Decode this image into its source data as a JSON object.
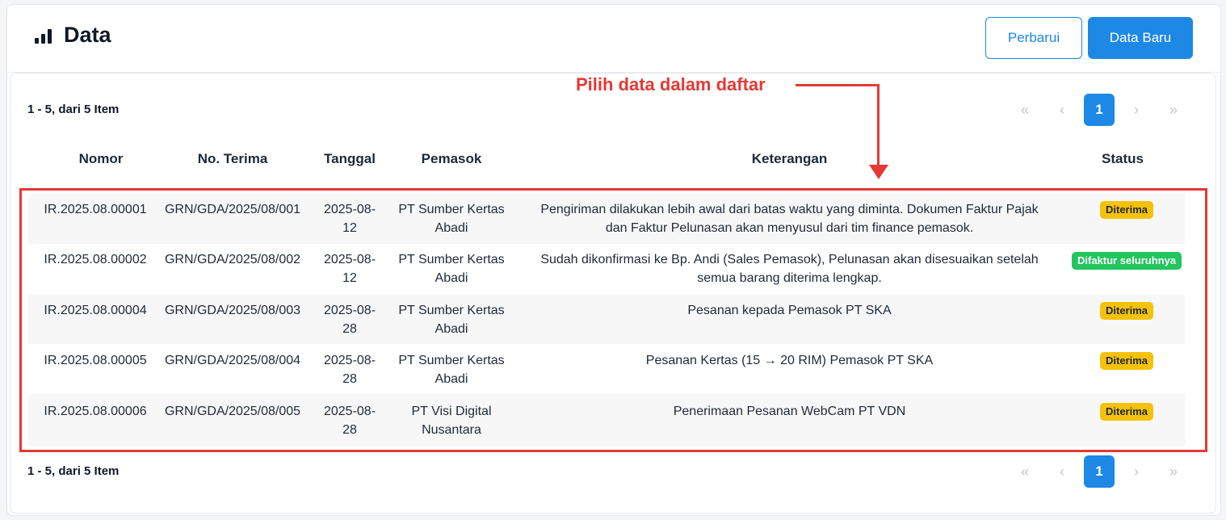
{
  "header": {
    "title": "Data",
    "icon": "bar-chart-icon",
    "refresh_label": "Perbarui",
    "new_label": "Data Baru"
  },
  "annotation": {
    "text": "Pilih data dalam daftar",
    "color": "#e53935"
  },
  "summary": {
    "count_text": "1 - 5, dari 5 Item"
  },
  "pagination": {
    "first": "«",
    "prev": "‹",
    "current": "1",
    "next": "›",
    "last": "»"
  },
  "table": {
    "columns": [
      "Nomor",
      "No. Terima",
      "Tanggal",
      "Pemasok",
      "Keterangan",
      "Status"
    ],
    "rows": [
      {
        "nomor": "IR.2025.08.00001",
        "no_terima": "GRN/GDA/2025/08/001",
        "tanggal_1": "2025-08-",
        "tanggal_2": "12",
        "pemasok_1": "PT Sumber Kertas",
        "pemasok_2": "Abadi",
        "keterangan_1": "Pengiriman dilakukan lebih awal dari batas waktu yang diminta. Dokumen Faktur Pajak",
        "keterangan_2": "dan Faktur Pelunasan akan menyusul dari tim finance pemasok.",
        "status": "Diterima"
      },
      {
        "nomor": "IR.2025.08.00002",
        "no_terima": "GRN/GDA/2025/08/002",
        "tanggal_1": "2025-08-",
        "tanggal_2": "12",
        "pemasok_1": "PT Sumber Kertas",
        "pemasok_2": "Abadi",
        "keterangan_1": "Sudah dikonfirmasi ke Bp. Andi (Sales Pemasok), Pelunasan akan disesuaikan setelah",
        "keterangan_2": "semua barang diterima lengkap.",
        "status": "Difaktur seluruhnya"
      },
      {
        "nomor": "IR.2025.08.00004",
        "no_terima": "GRN/GDA/2025/08/003",
        "tanggal_1": "2025-08-",
        "tanggal_2": "28",
        "pemasok_1": "PT Sumber Kertas",
        "pemasok_2": "Abadi",
        "keterangan_1": "Pesanan kepada Pemasok PT SKA",
        "keterangan_2": "",
        "status": "Diterima"
      },
      {
        "nomor": "IR.2025.08.00005",
        "no_terima": "GRN/GDA/2025/08/004",
        "tanggal_1": "2025-08-",
        "tanggal_2": "28",
        "pemasok_1": "PT Sumber Kertas",
        "pemasok_2": "Abadi",
        "keterangan_1": "Pesanan Kertas (15 → 20 RIM) Pemasok PT SKA",
        "keterangan_2": "",
        "status": "Diterima"
      },
      {
        "nomor": "IR.2025.08.00006",
        "no_terima": "GRN/GDA/2025/08/005",
        "tanggal_1": "2025-08-",
        "tanggal_2": "28",
        "pemasok_1": "PT Visi Digital",
        "pemasok_2": "Nusantara",
        "keterangan_1": "Penerimaan Pesanan WebCam PT VDN",
        "keterangan_2": "",
        "status": "Diterima"
      }
    ]
  },
  "colors": {
    "primary": "#1e88e5",
    "status_received": "#f5c20b",
    "status_invoiced": "#22c55e"
  }
}
